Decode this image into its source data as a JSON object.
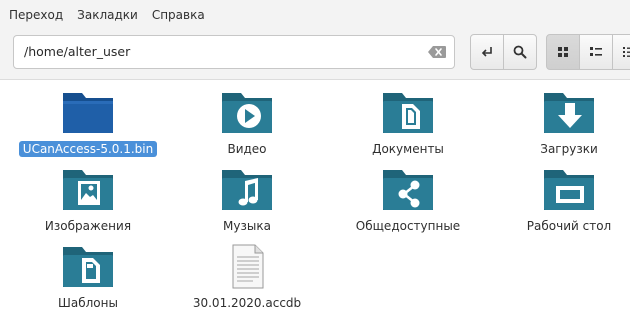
{
  "menu": {
    "items": [
      {
        "label": "Переход"
      },
      {
        "label": "Закладки"
      },
      {
        "label": "Справка"
      }
    ]
  },
  "toolbar": {
    "location_value": "/home/alter_user",
    "clear_icon": "backspace-icon",
    "buttons": {
      "go": "enter-icon",
      "search": "search-icon",
      "icon_view": "grid-view-icon",
      "list_view": "list-view-icon",
      "compact_view": "compact-view-icon"
    }
  },
  "files": [
    {
      "name": "UCanAccess-5.0.1.bin",
      "icon": "folder-dark-icon",
      "selected": true
    },
    {
      "name": "Видео",
      "icon": "folder-video-icon"
    },
    {
      "name": "Документы",
      "icon": "folder-documents-icon"
    },
    {
      "name": "Загрузки",
      "icon": "folder-downloads-icon"
    },
    {
      "name": "Изображения",
      "icon": "folder-pictures-icon"
    },
    {
      "name": "Музыка",
      "icon": "folder-music-icon"
    },
    {
      "name": "Общедоступные",
      "icon": "folder-public-icon"
    },
    {
      "name": "Рабочий стол",
      "icon": "folder-desktop-icon"
    },
    {
      "name": "Шаблоны",
      "icon": "folder-templates-icon"
    },
    {
      "name": "30.01.2020.accdb",
      "icon": "file-document-icon"
    }
  ],
  "colors": {
    "folder_teal": "#2a7d96",
    "folder_teal_dark": "#1f6479",
    "folder_blue": "#1f5fa8",
    "selection": "#4a90d9"
  }
}
